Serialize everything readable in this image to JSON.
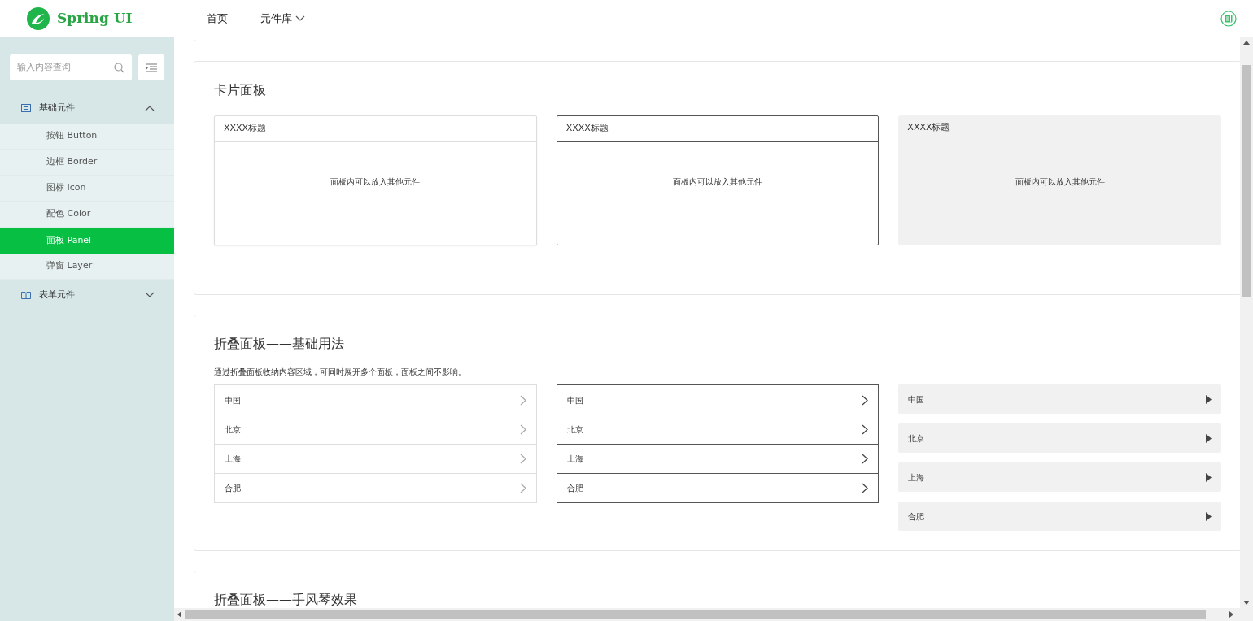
{
  "header": {
    "logo": "Spring UI",
    "nav": [
      {
        "label": "首页",
        "dropdown": false
      },
      {
        "label": "元件库",
        "dropdown": true
      }
    ]
  },
  "sidebar": {
    "search": {
      "placeholder": "输入内容查询"
    },
    "groups": [
      {
        "label": "基础元件",
        "kind": "basic",
        "expanded": true,
        "children": [
          {
            "label": "按钮 Button",
            "selected": false
          },
          {
            "label": "边框 Border",
            "selected": false
          },
          {
            "label": "图标 Icon",
            "selected": false
          },
          {
            "label": "配色 Color",
            "selected": false
          },
          {
            "label": "面板 Panel",
            "selected": true
          },
          {
            "label": "弹窗 Layer",
            "selected": false
          }
        ]
      },
      {
        "label": "表单元件",
        "kind": "form",
        "expanded": false
      }
    ]
  },
  "sections": [
    {
      "kind": "cards",
      "title": "卡片面板",
      "panels": [
        {
          "kind": "light",
          "title": "XXXX标题",
          "body": "面板内可以放入其他元件"
        },
        {
          "kind": "dark",
          "title": "XXXX标题",
          "body": "面板内可以放入其他元件"
        },
        {
          "kind": "filled",
          "title": "XXXX标题",
          "body": "面板内可以放入其他元件"
        }
      ]
    },
    {
      "kind": "collapse",
      "title": "折叠面板——基础用法",
      "description": "通过折叠面板收纳内容区域，可同时展开多个面板，面板之间不影响。",
      "lists": [
        {
          "kind": "light",
          "items": [
            "中国",
            "北京",
            "上海",
            "合肥"
          ]
        },
        {
          "kind": "dark",
          "items": [
            "中国",
            "北京",
            "上海",
            "合肥"
          ]
        },
        {
          "kind": "filled",
          "items": [
            "中国",
            "北京",
            "上海",
            "合肥"
          ]
        }
      ]
    },
    {
      "kind": "collapse",
      "title": "折叠面板——手风琴效果"
    }
  ]
}
